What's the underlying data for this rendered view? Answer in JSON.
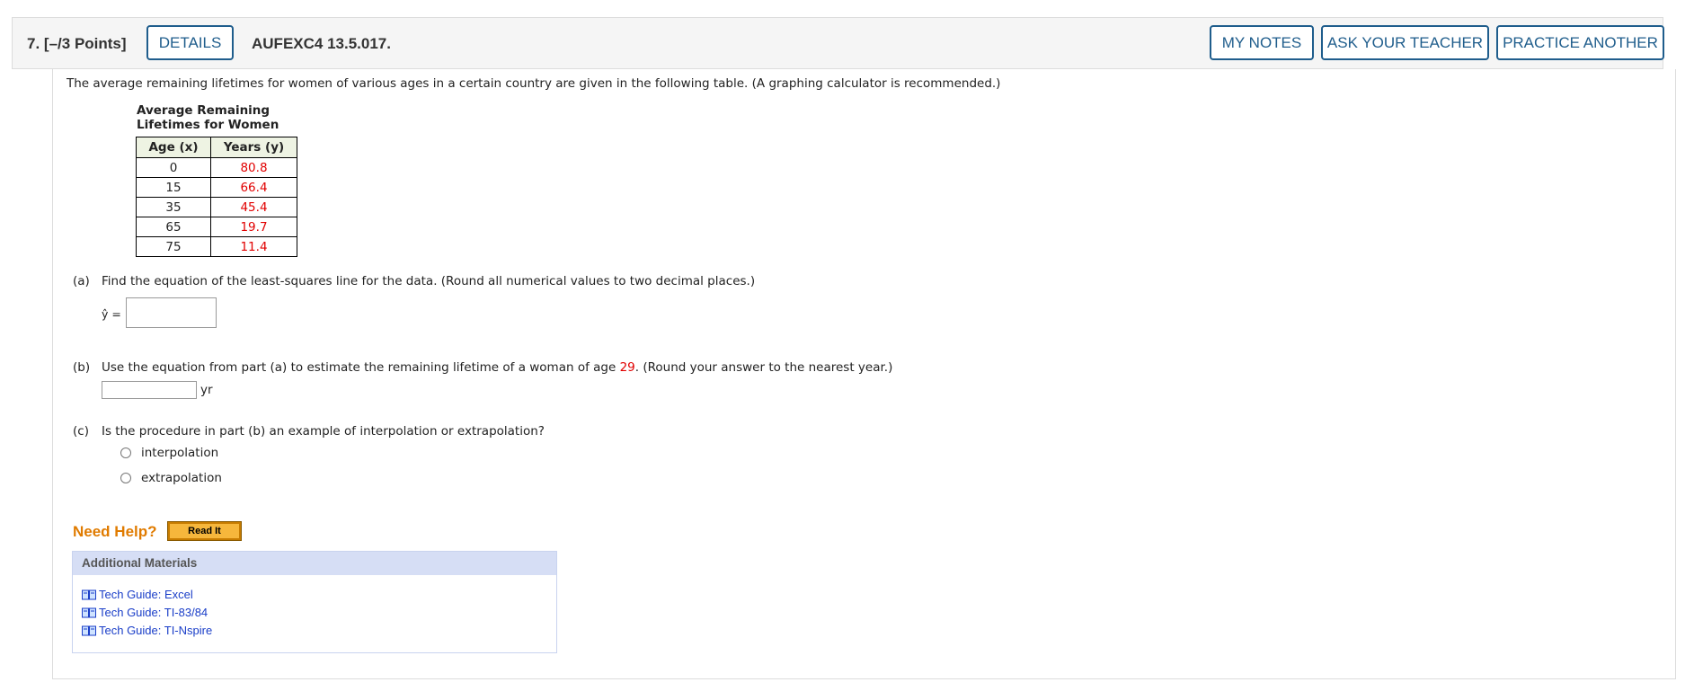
{
  "header": {
    "question_number": "7.",
    "points": "[–/3 Points]",
    "details_label": "DETAILS",
    "code": "AUFEXC4 13.5.017.",
    "my_notes_label": "MY NOTES",
    "ask_teacher_label": "ASK YOUR TEACHER",
    "practice_label": "PRACTICE ANOTHER"
  },
  "intro": "The average remaining lifetimes for women of various ages in a certain country are given in the following table. (A graphing calculator is recommended.)",
  "table": {
    "caption_line1": "Average Remaining",
    "caption_line2": "Lifetimes for Women",
    "col_age": "Age (x)",
    "col_years": "Years (y)",
    "rows": [
      {
        "age": "0",
        "years": "80.8"
      },
      {
        "age": "15",
        "years": "66.4"
      },
      {
        "age": "35",
        "years": "45.4"
      },
      {
        "age": "65",
        "years": "19.7"
      },
      {
        "age": "75",
        "years": "11.4"
      }
    ]
  },
  "part_a": {
    "label": "(a)",
    "text": "Find the equation of the least-squares line for the data. (Round all numerical values to two decimal places.)",
    "yhat_label": "ŷ =",
    "answer": ""
  },
  "part_b": {
    "label": "(b)",
    "text_before": "Use the equation from part (a) to estimate the remaining lifetime of a woman of age ",
    "age": "29",
    "text_after": ". (Round your answer to the nearest year.)",
    "unit": "yr",
    "answer": ""
  },
  "part_c": {
    "label": "(c)",
    "text": "Is the procedure in part (b) an example of interpolation or extrapolation?",
    "options": [
      "interpolation",
      "extrapolation"
    ]
  },
  "help": {
    "need_help": "Need Help?",
    "read_it": "Read It",
    "additional_materials": "Additional Materials",
    "links": [
      "Tech Guide: Excel",
      "Tech Guide: TI-83/84",
      "Tech Guide: TI-Nspire"
    ]
  },
  "colors": {
    "accent": "#1f5d8c",
    "highlight_red": "#e10000",
    "need_help_orange": "#e07b00",
    "link_blue": "#1a3ec8"
  }
}
